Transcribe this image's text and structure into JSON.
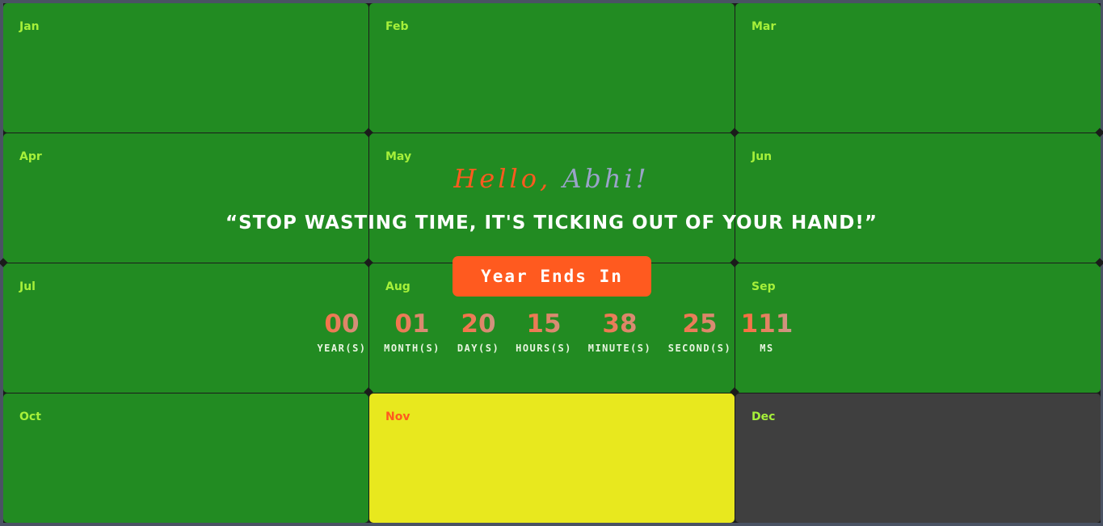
{
  "months": [
    {
      "label": "Jan",
      "state": "past"
    },
    {
      "label": "Feb",
      "state": "past"
    },
    {
      "label": "Mar",
      "state": "past"
    },
    {
      "label": "Apr",
      "state": "past"
    },
    {
      "label": "May",
      "state": "past"
    },
    {
      "label": "Jun",
      "state": "past"
    },
    {
      "label": "Jul",
      "state": "past"
    },
    {
      "label": "Aug",
      "state": "past"
    },
    {
      "label": "Sep",
      "state": "past"
    },
    {
      "label": "Oct",
      "state": "past"
    },
    {
      "label": "Nov",
      "state": "current"
    },
    {
      "label": "Dec",
      "state": "upcoming"
    }
  ],
  "greeting": {
    "hello": "Hello,",
    "name": "Abhi!"
  },
  "quote": "“STOP WASTING TIME, IT'S TICKING OUT OF YOUR HAND!”",
  "year_button_label": "Year Ends In",
  "countdown": {
    "years": {
      "value": "00",
      "label": "YEAR(S)"
    },
    "months": {
      "value": "01",
      "label": "MONTH(S)"
    },
    "days": {
      "value": "20",
      "label": "DAY(S)"
    },
    "hours": {
      "value": "15",
      "label": "HOURS(S)"
    },
    "minutes": {
      "value": "38",
      "label": "MINUTE(S)"
    },
    "seconds": {
      "value": "25",
      "label": "SECOND(S)"
    },
    "ms": {
      "value": "111",
      "label": "MS"
    }
  },
  "colors": {
    "past_month": "#228b22",
    "current_month": "#e8e81e",
    "upcoming_month": "#3f3f3f",
    "accent": "#ff5a1f",
    "month_label": "#a6f03a"
  }
}
